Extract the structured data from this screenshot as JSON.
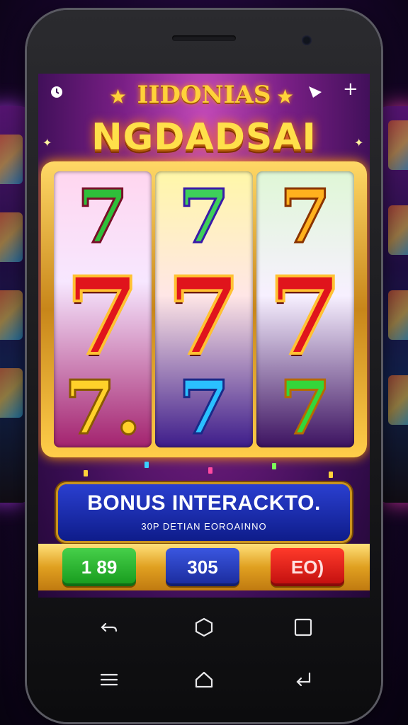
{
  "game": {
    "title_top": "IIDONIAS",
    "title_main": "NGDADSAI"
  },
  "reels": [
    {
      "top": "7",
      "middle": "7",
      "bottom": "7."
    },
    {
      "top": "7",
      "middle": "7",
      "bottom": "7"
    },
    {
      "top": "7",
      "middle": "7",
      "bottom": "7"
    }
  ],
  "bonus": {
    "title": "BONUS INTERACKTO.",
    "subtitle": "30P DETIAN EOROAINNO"
  },
  "controls": {
    "green_value": "1 89",
    "blue_value": "305",
    "red_value": "EO)"
  },
  "icons": {
    "top_left": "clock-icon",
    "top_right_1": "play-flag-icon",
    "top_right_2": "plus-icon",
    "nav_back": "back-arrow-icon",
    "nav_home": "hexagon-home-icon",
    "nav_recent": "square-recents-icon",
    "nav_menu": "menu-lines-icon",
    "nav_home2": "home-outline-icon",
    "nav_return": "return-arrow-icon"
  },
  "colors": {
    "gold": "#ffd23a",
    "bonus_blue": "#1a2fb0",
    "green_button": "#22b02a",
    "blue_button": "#2a3fc0",
    "red_button": "#e01818"
  }
}
